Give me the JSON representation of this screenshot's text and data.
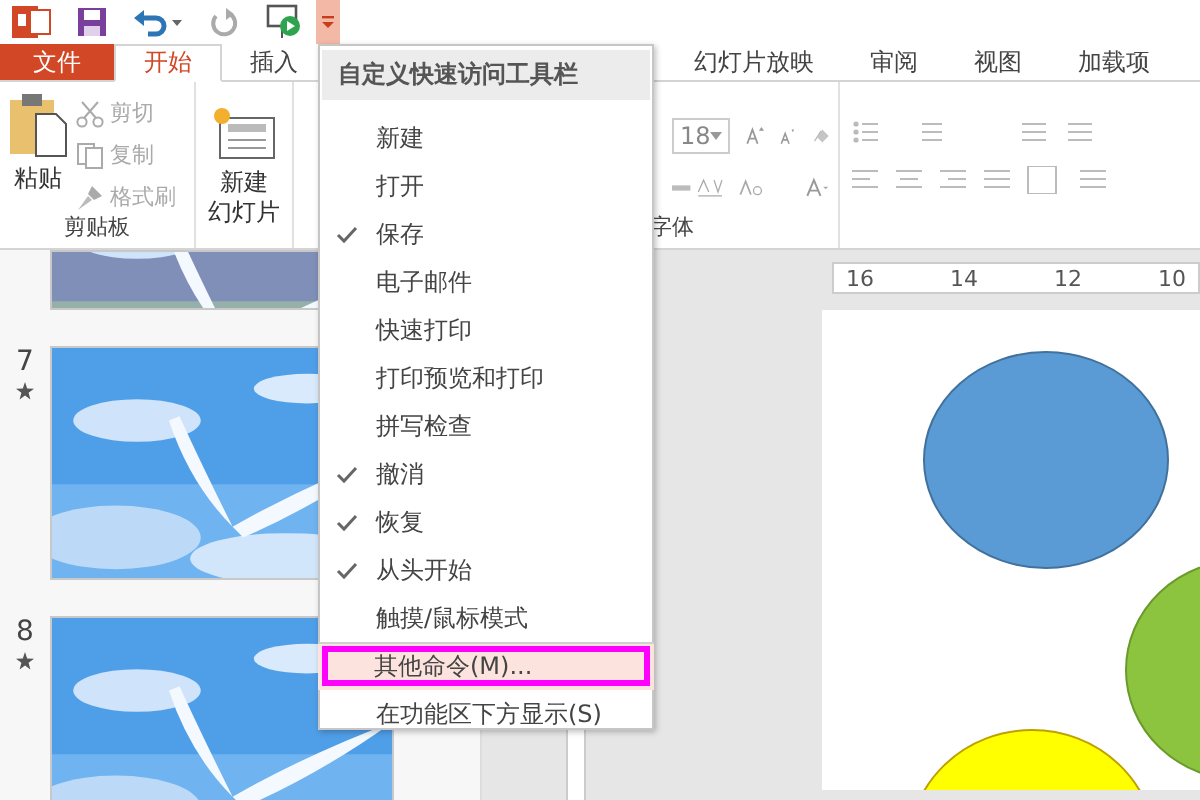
{
  "ribbon_tabs": [
    {
      "label": "文件",
      "kind": "file",
      "selected": false
    },
    {
      "label": "开始",
      "kind": "tab",
      "selected": true
    },
    {
      "label": "插入",
      "kind": "tab",
      "selected": false
    },
    {
      "label": "幻灯片放映",
      "kind": "tab",
      "selected": false
    },
    {
      "label": "审阅",
      "kind": "tab",
      "selected": false
    },
    {
      "label": "视图",
      "kind": "tab",
      "selected": false
    },
    {
      "label": "加载项",
      "kind": "tab",
      "selected": false
    }
  ],
  "clipboard": {
    "paste": "粘贴",
    "cut": "剪切",
    "copy": "复制",
    "format_painter": "格式刷",
    "group_label": "剪贴板"
  },
  "slides_group": {
    "new_slide": [
      "新建",
      "幻灯片"
    ]
  },
  "font_group": {
    "font_size": "18",
    "group_label": "字体"
  },
  "ruler": [
    "16",
    "14",
    "12",
    "10"
  ],
  "thumbnails": [
    {
      "animated": false
    },
    {
      "number": "7",
      "animated": true
    },
    {
      "number": "8",
      "animated": true
    }
  ],
  "qat_menu": {
    "title": "自定义快速访问工具栏",
    "items": [
      {
        "label": "新建",
        "checked": false,
        "selected": false
      },
      {
        "label": "打开",
        "checked": false,
        "selected": false
      },
      {
        "label": "保存",
        "checked": true,
        "selected": false
      },
      {
        "label": "电子邮件",
        "checked": false,
        "selected": false
      },
      {
        "label": "快速打印",
        "checked": false,
        "selected": false
      },
      {
        "label": "打印预览和打印",
        "checked": false,
        "selected": false
      },
      {
        "label": "拼写检查",
        "checked": false,
        "selected": false
      },
      {
        "label": "撤消",
        "checked": true,
        "selected": false
      },
      {
        "label": "恢复",
        "checked": true,
        "selected": false
      },
      {
        "label": "从头开始",
        "checked": true,
        "selected": false
      },
      {
        "label": "触摸/鼠标模式",
        "checked": false,
        "selected": false
      },
      {
        "label": "其他命令(M)...",
        "checked": false,
        "selected": true,
        "separator_before": true
      },
      {
        "label": "在功能区下方显示(S)",
        "checked": false,
        "selected": false
      }
    ]
  }
}
